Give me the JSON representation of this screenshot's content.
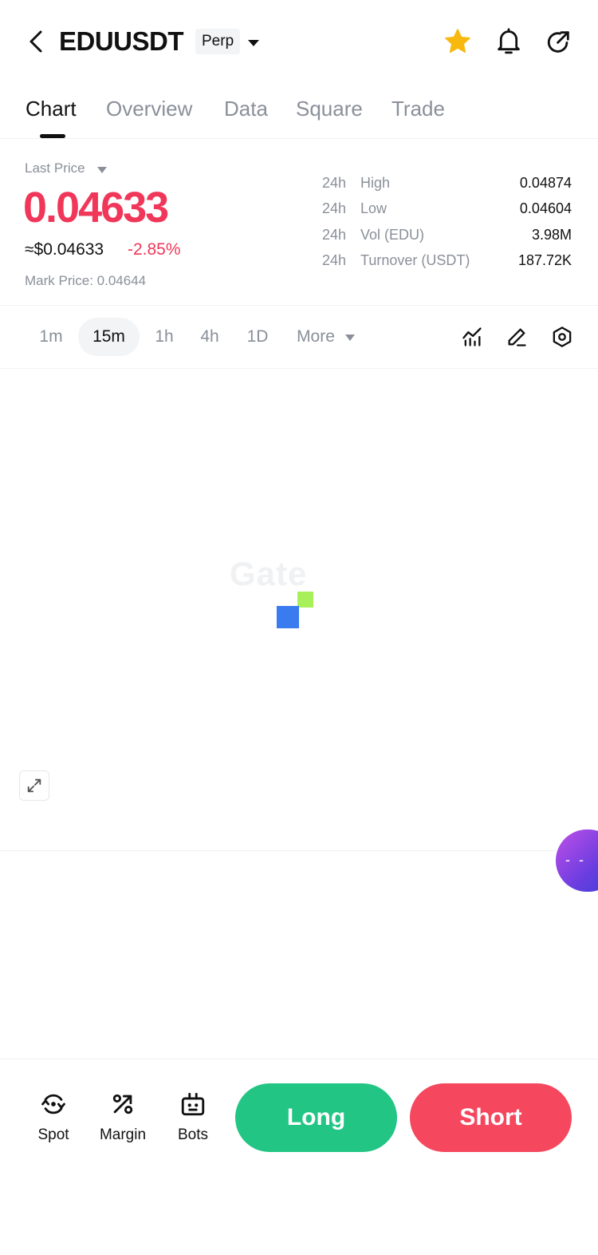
{
  "header": {
    "pair": "EDUUSDT",
    "contract_type": "Perp"
  },
  "tabs": [
    {
      "label": "Chart",
      "active": true
    },
    {
      "label": "Overview",
      "active": false
    },
    {
      "label": "Data",
      "active": false
    },
    {
      "label": "Square",
      "active": false
    },
    {
      "label": "Trade",
      "active": false
    }
  ],
  "price": {
    "last_price_label": "Last Price",
    "last_price": "0.04633",
    "usd_value": "≈$0.04633",
    "change": "-2.85%",
    "mark_price": "Mark Price: 0.04644",
    "stats": [
      {
        "prefix": "24h",
        "name": "High",
        "value": "0.04874"
      },
      {
        "prefix": "24h",
        "name": "Low",
        "value": "0.04604"
      },
      {
        "prefix": "24h",
        "name": "Vol (EDU)",
        "value": "3.98M"
      },
      {
        "prefix": "24h",
        "name": "Turnover (USDT)",
        "value": "187.72K"
      }
    ]
  },
  "intervals": {
    "items": [
      "1m",
      "15m",
      "1h",
      "4h",
      "1D"
    ],
    "selected": "15m",
    "more_label": "More"
  },
  "chart": {
    "watermark": "Gate",
    "bubble_text": "- -"
  },
  "bottom_nav": [
    {
      "label": "Spot",
      "icon": "spot-icon"
    },
    {
      "label": "Margin",
      "icon": "margin-icon"
    },
    {
      "label": "Bots",
      "icon": "bots-icon"
    }
  ],
  "actions": {
    "long_label": "Long",
    "short_label": "Short"
  },
  "colors": {
    "price_down": "#f0375a",
    "long": "#23c584",
    "short": "#f5475e",
    "star": "#f8b90f"
  }
}
